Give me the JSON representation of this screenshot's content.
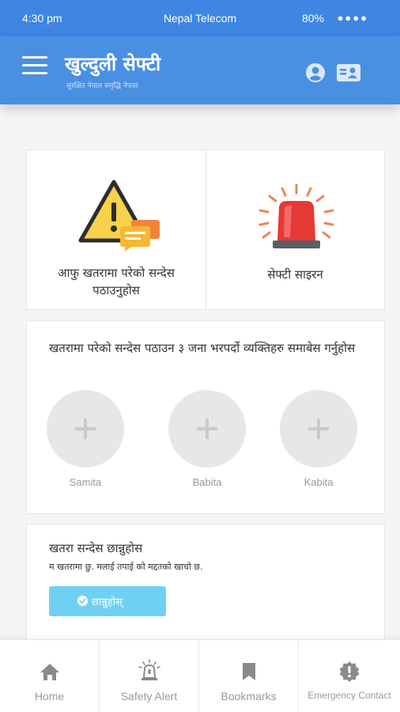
{
  "status_bar": {
    "time": "4:30 pm",
    "carrier": "Nepal Telecom",
    "battery": "80%",
    "signal": "●●●●"
  },
  "app_bar": {
    "title": "खुल्दुली सेफ्टी",
    "subtitle": "सुरक्षित नेपाल समृद्धि नेपाल",
    "menu_icon": "menu-icon",
    "profile_icon": "profile-icon",
    "contact_icon": "contact-card-icon"
  },
  "tiles": [
    {
      "label": "आफु खतरामा परेको सन्देस पठाउनुहोस",
      "icon": "warning-message-icon"
    },
    {
      "label": "सेफ्टी साइरन",
      "icon": "siren-icon"
    }
  ],
  "trusted_contacts": {
    "heading": "खतरामा परेको सन्देस पठाउन ३ जना भरपर्दो व्यक्तिहरु समाबेस गर्नुहोस",
    "contacts": [
      {
        "name": "Samita"
      },
      {
        "name": "Babita"
      },
      {
        "name": "Kabita"
      }
    ]
  },
  "alert_message": {
    "heading": "खतरा सन्देस छान्नुहोस",
    "message": "म खतरामा छु. मलाई तपाई को मद्दतको खाचो छ.",
    "button_label": "छान्नुहोस्"
  },
  "bottom_nav": [
    {
      "label": "Home",
      "icon": "home-icon"
    },
    {
      "label": "Safety Alert",
      "icon": "alarm-icon"
    },
    {
      "label": "Bookmarks",
      "icon": "bookmark-icon"
    },
    {
      "label": "Emergency Contact",
      "icon": "emergency-icon"
    }
  ],
  "colors": {
    "primary": "#4a90e2",
    "button": "#6fd1f2",
    "siren_red": "#e53935",
    "warning_yellow": "#f7d24a"
  }
}
